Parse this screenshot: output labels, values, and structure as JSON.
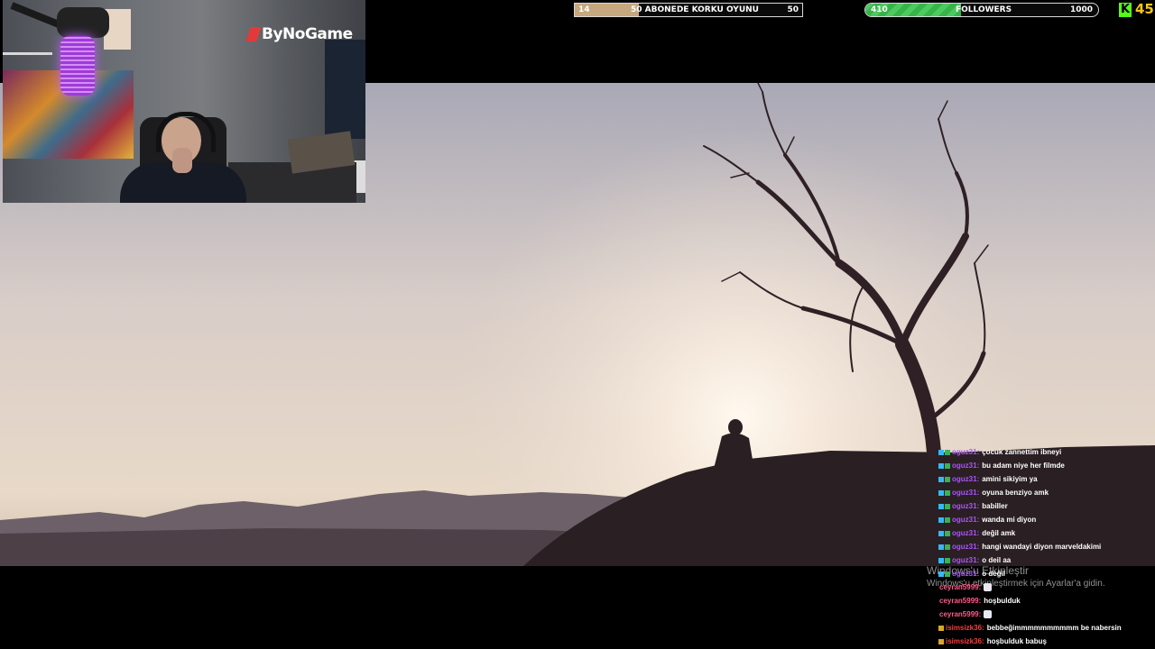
{
  "top_bar": {
    "subscriber_goal": {
      "current": "14",
      "label": "50 ABONEDE KORKU OYUNU",
      "target": "50",
      "progress": 0.28,
      "fill_color": "#c7a77d"
    },
    "followers_goal": {
      "current": "410",
      "label": "FOLLOWERS",
      "target": "1000",
      "progress": 0.41,
      "fill_color": "#3ec053"
    },
    "kick": {
      "icon": "kick-logo-icon",
      "logo_text": "K",
      "viewer_count": "45",
      "accent": "#53fc18"
    }
  },
  "webcam": {
    "brand_logo": "ByNoGame"
  },
  "watermark": {
    "title": "Windows'u Etkinleştir",
    "subtitle": "Windows'u etkinleştirmek için Ayarlar'a gidin."
  },
  "chat": {
    "colors": {
      "oguz31": "#a855f7",
      "ceyran5999": "#ff5c8a",
      "isimsizk36": "#ff3b3b"
    },
    "messages": [
      {
        "user": "oguz31",
        "badges": [
          "sub",
          "mod"
        ],
        "text": "çocuk zannettim ibneyi"
      },
      {
        "user": "oguz31",
        "badges": [
          "sub",
          "mod"
        ],
        "text": "bu adam niye her filmde"
      },
      {
        "user": "oguz31",
        "badges": [
          "sub",
          "mod"
        ],
        "text": "amini sikiyim ya"
      },
      {
        "user": "oguz31",
        "badges": [
          "sub",
          "mod"
        ],
        "text": "oyuna benziyo amk"
      },
      {
        "user": "oguz31",
        "badges": [
          "sub",
          "mod"
        ],
        "text": "babiller"
      },
      {
        "user": "oguz31",
        "badges": [
          "sub",
          "mod"
        ],
        "text": "wanda mi diyon"
      },
      {
        "user": "oguz31",
        "badges": [
          "sub",
          "mod"
        ],
        "text": "değil amk"
      },
      {
        "user": "oguz31",
        "badges": [
          "sub",
          "mod"
        ],
        "text": "hangi wandayi diyon marveldakimi"
      },
      {
        "user": "oguz31",
        "badges": [
          "sub",
          "mod"
        ],
        "text": "o deil aa"
      },
      {
        "user": "oguz31",
        "badges": [
          "sub",
          "mod"
        ],
        "text": "o değil"
      },
      {
        "user": "ceyran5999",
        "badges": [],
        "text": "",
        "emote": "cat-emote-icon"
      },
      {
        "user": "ceyran5999",
        "badges": [],
        "text": "hoşbulduk"
      },
      {
        "user": "ceyran5999",
        "badges": [],
        "text": "",
        "emote": "ghost-emote-icon"
      },
      {
        "user": "isimsizk36",
        "badges": [
          "gift"
        ],
        "text": "bebbeğimmmmmmmmmm be nabersin"
      },
      {
        "user": "isimsizk36",
        "badges": [
          "gift"
        ],
        "text": "hoşbulduk babuş"
      }
    ]
  }
}
